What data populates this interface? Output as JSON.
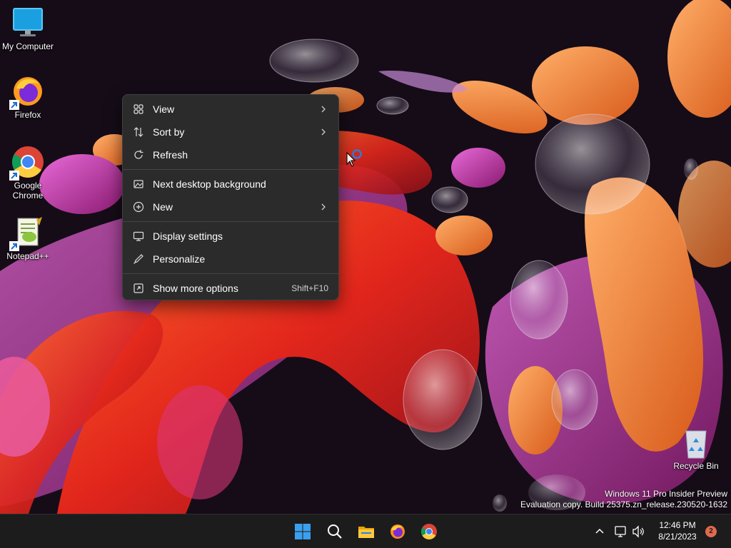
{
  "desktop": {
    "icons": [
      {
        "label": "My Computer",
        "icon": "computer-icon"
      },
      {
        "label": "Firefox",
        "icon": "firefox-icon"
      },
      {
        "label": "Google Chrome",
        "icon": "chrome-icon"
      },
      {
        "label": "Notepad++",
        "icon": "notepadpp-icon"
      },
      {
        "label": "Recycle Bin",
        "icon": "recycle-bin-icon"
      }
    ],
    "watermark": {
      "line1": "Windows 11 Pro Insider Preview",
      "line2": "Evaluation copy. Build 25375.zn_release.230520-1632"
    }
  },
  "context_menu": {
    "items": [
      {
        "label": "View",
        "icon": "view-grid-icon",
        "submenu": true
      },
      {
        "label": "Sort by",
        "icon": "sort-icon",
        "submenu": true
      },
      {
        "label": "Refresh",
        "icon": "refresh-icon"
      },
      {
        "label": "Next desktop background",
        "icon": "next-background-icon"
      },
      {
        "label": "New",
        "icon": "new-plus-icon",
        "submenu": true
      },
      {
        "label": "Display settings",
        "icon": "display-icon"
      },
      {
        "label": "Personalize",
        "icon": "pen-icon"
      },
      {
        "label": "Show more options",
        "icon": "more-options-icon",
        "shortcut": "Shift+F10"
      }
    ]
  },
  "taskbar": {
    "apps": [
      "start-icon",
      "search-icon",
      "file-explorer-icon",
      "firefox-icon",
      "chrome-icon"
    ],
    "tray": {
      "time": "12:46 PM",
      "date": "8/21/2023",
      "notification_count": "2"
    }
  },
  "colors": {
    "menu_bg": "#2b2b2b",
    "taskbar_bg": "#1c1c1c",
    "accent": "#0078d4",
    "badge": "#e06a4e"
  }
}
